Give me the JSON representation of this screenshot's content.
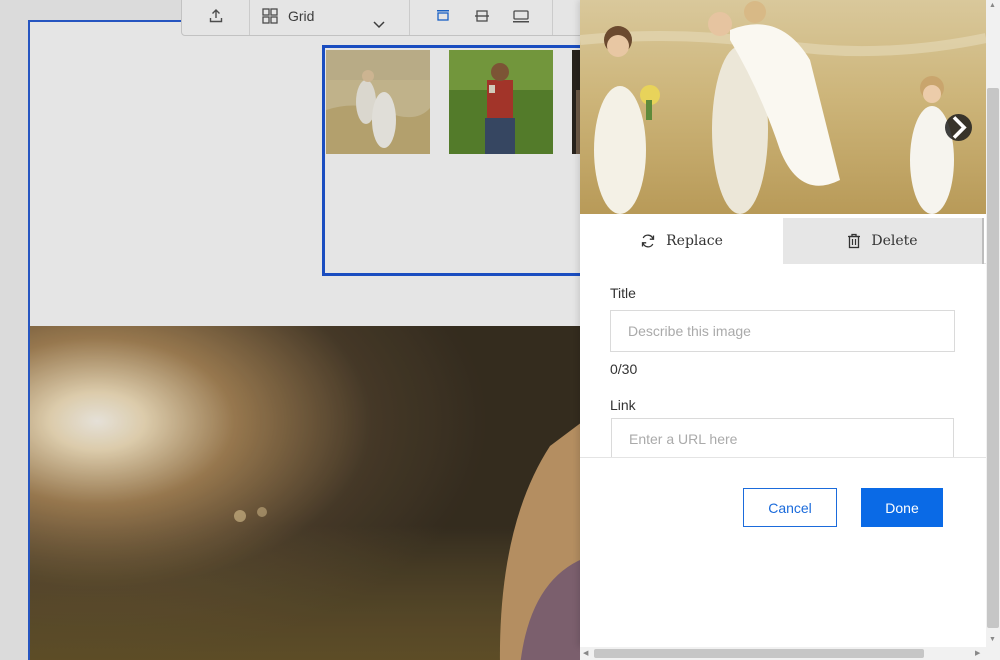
{
  "toolbar": {
    "layout_label": "Grid",
    "icons": [
      "upload-icon",
      "grid-icon",
      "chevron-down-icon",
      "align-top-icon",
      "align-middle-icon",
      "align-bottom-icon"
    ]
  },
  "panel": {
    "actions": {
      "replace_label": "Replace",
      "delete_label": "Delete"
    },
    "title_field": {
      "label": "Title",
      "placeholder": "Describe this image",
      "value": "",
      "counter": "0/30"
    },
    "link_field": {
      "label": "Link",
      "placeholder": "Enter a URL here",
      "value": ""
    },
    "buttons": {
      "cancel_label": "Cancel",
      "done_label": "Done"
    }
  },
  "colors": {
    "accent": "#1b6bdb",
    "done_button": "#0a6ae6",
    "selection_border": "#1d56d6"
  }
}
